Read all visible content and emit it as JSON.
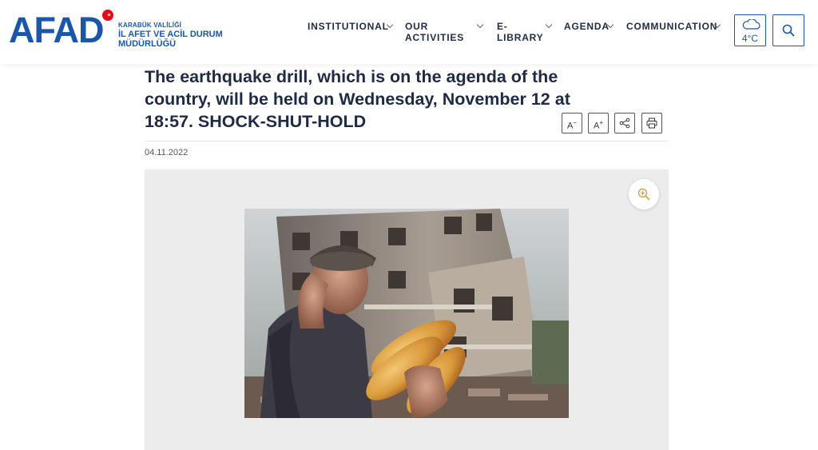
{
  "header": {
    "logo_word": "AFAD",
    "logo_line1": "KARABÜK VALİLİĞİ",
    "logo_line2": "İL AFET VE ACİL DURUM",
    "logo_line3": "MÜDÜRLÜĞÜ",
    "brand_color": "#1a57a8",
    "nav": {
      "institutional": "INSTITUTIONAL",
      "our_activities_1": "OUR",
      "our_activities_2": "ACTIVITIES",
      "elibrary_1": "E-",
      "elibrary_2": "LIBRARY",
      "agenda": "AGENDA",
      "communication": "COMMUNICATION"
    },
    "weather": {
      "icon": "cloud-icon",
      "temperature": "4°C"
    },
    "search": {
      "icon": "search-icon"
    }
  },
  "article": {
    "title": "The earthquake drill, which is on the agenda of the country, will be held on Wednesday, November 12 at 18:57. SHOCK-SHUT-HOLD",
    "tools": {
      "decrease_font": "A",
      "decrease_sign": "−",
      "increase_font": "A",
      "increase_sign": "+",
      "share_icon": "share-icon",
      "print_icon": "print-icon"
    },
    "date": "04.11.2022",
    "image": {
      "description_icon": "zoom-in-icon"
    }
  }
}
